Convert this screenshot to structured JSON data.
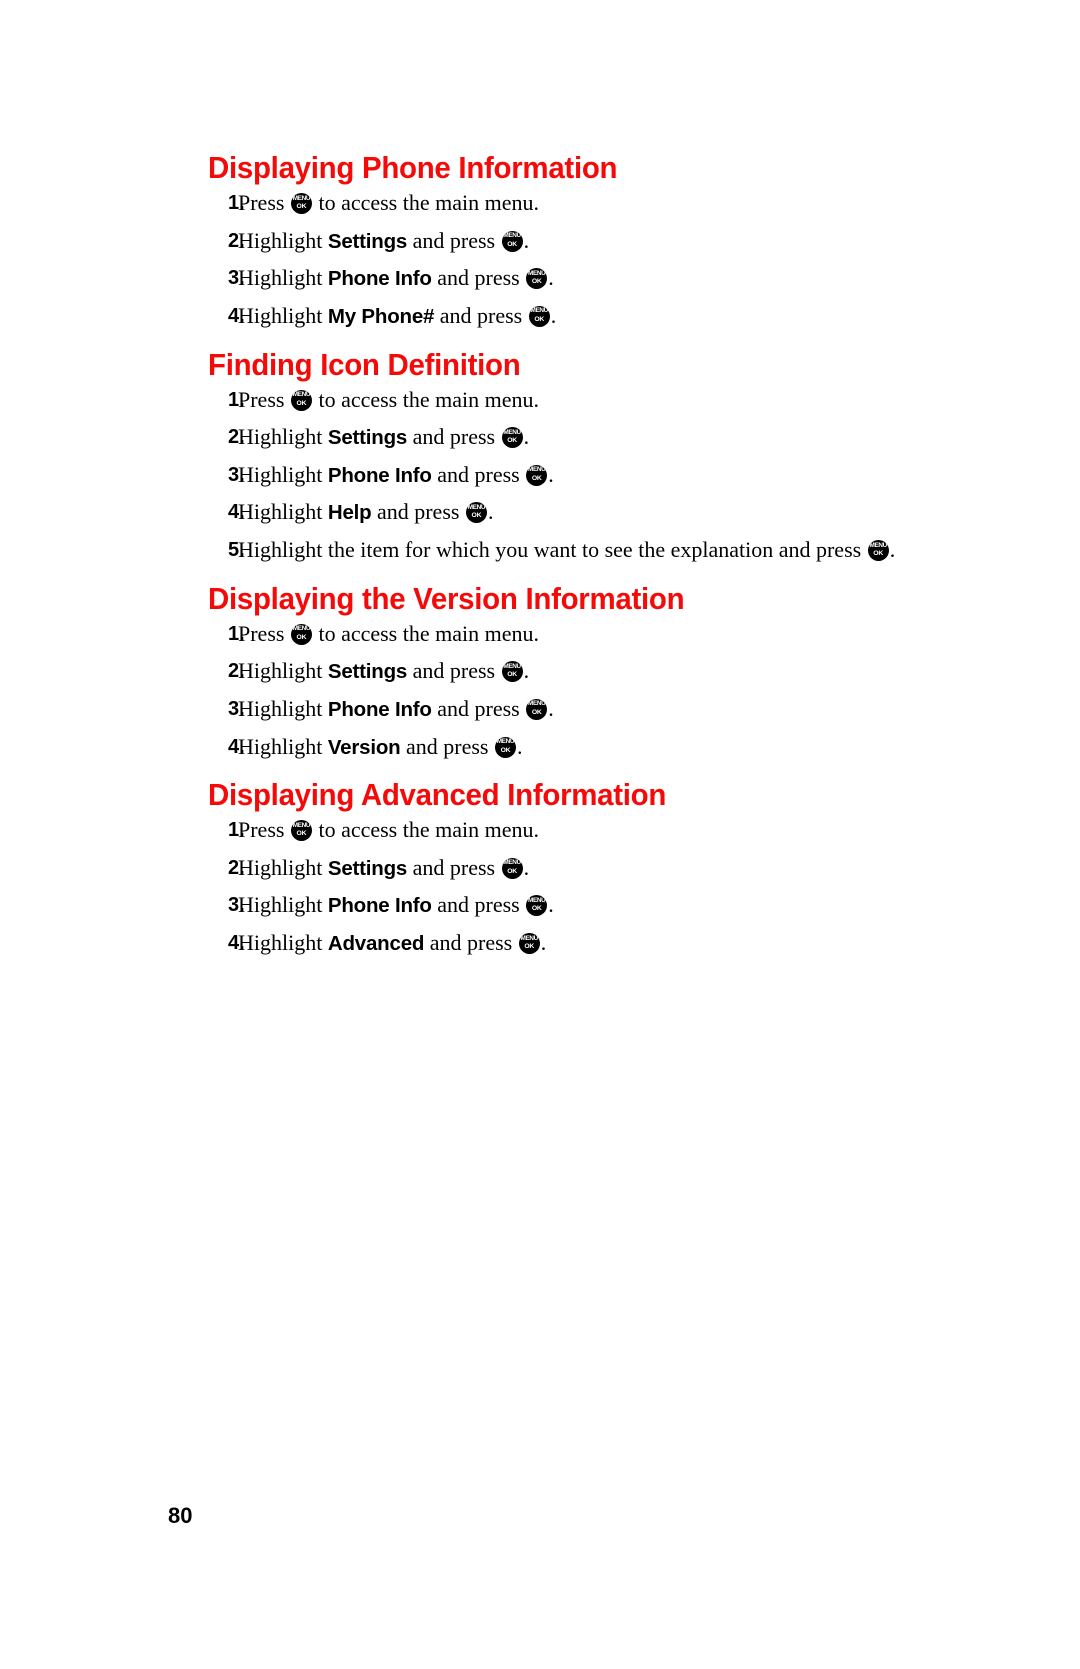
{
  "document": {
    "page_number": "80",
    "heading_color": "#f50a0a",
    "body_color": "#000000",
    "background_color": "#ffffff"
  },
  "key_icon": {
    "name": "menu-ok-key-icon",
    "top_label": "MENU",
    "bottom_label": "OK"
  },
  "sections": [
    {
      "heading": "Displaying Phone Information",
      "steps": [
        {
          "number": "1.",
          "parts": [
            {
              "type": "text",
              "value": "Press "
            },
            {
              "type": "icon"
            },
            {
              "type": "text",
              "value": " to access the main menu."
            }
          ]
        },
        {
          "number": "2.",
          "parts": [
            {
              "type": "text",
              "value": "Highlight "
            },
            {
              "type": "menu",
              "value": "Settings"
            },
            {
              "type": "text",
              "value": " and press "
            },
            {
              "type": "icon"
            },
            {
              "type": "text",
              "value": "."
            }
          ]
        },
        {
          "number": "3.",
          "parts": [
            {
              "type": "text",
              "value": "Highlight "
            },
            {
              "type": "menu",
              "value": "Phone Info"
            },
            {
              "type": "text",
              "value": " and press "
            },
            {
              "type": "icon"
            },
            {
              "type": "text",
              "value": "."
            }
          ]
        },
        {
          "number": "4.",
          "parts": [
            {
              "type": "text",
              "value": "Highlight "
            },
            {
              "type": "menu",
              "value": "My Phone#"
            },
            {
              "type": "text",
              "value": " and press "
            },
            {
              "type": "icon"
            },
            {
              "type": "text",
              "value": "."
            }
          ]
        }
      ]
    },
    {
      "heading": "Finding Icon Definition",
      "steps": [
        {
          "number": "1.",
          "parts": [
            {
              "type": "text",
              "value": "Press "
            },
            {
              "type": "icon"
            },
            {
              "type": "text",
              "value": " to access the main menu."
            }
          ]
        },
        {
          "number": "2.",
          "parts": [
            {
              "type": "text",
              "value": "Highlight "
            },
            {
              "type": "menu",
              "value": "Settings"
            },
            {
              "type": "text",
              "value": " and press "
            },
            {
              "type": "icon"
            },
            {
              "type": "text",
              "value": "."
            }
          ]
        },
        {
          "number": "3.",
          "parts": [
            {
              "type": "text",
              "value": "Highlight "
            },
            {
              "type": "menu",
              "value": "Phone Info"
            },
            {
              "type": "text",
              "value": " and press "
            },
            {
              "type": "icon"
            },
            {
              "type": "text",
              "value": "."
            }
          ]
        },
        {
          "number": "4.",
          "parts": [
            {
              "type": "text",
              "value": "Highlight "
            },
            {
              "type": "menu",
              "value": "Help"
            },
            {
              "type": "text",
              "value": " and press "
            },
            {
              "type": "icon"
            },
            {
              "type": "text",
              "value": "."
            }
          ]
        },
        {
          "number": "5.",
          "parts": [
            {
              "type": "text",
              "value": "Highlight the item for which you want to see the explanation and press "
            },
            {
              "type": "icon"
            },
            {
              "type": "text",
              "value": "."
            }
          ]
        }
      ]
    },
    {
      "heading": "Displaying the Version Information",
      "steps": [
        {
          "number": "1.",
          "parts": [
            {
              "type": "text",
              "value": "Press "
            },
            {
              "type": "icon"
            },
            {
              "type": "text",
              "value": " to access the main menu."
            }
          ]
        },
        {
          "number": "2.",
          "parts": [
            {
              "type": "text",
              "value": "Highlight "
            },
            {
              "type": "menu",
              "value": "Settings"
            },
            {
              "type": "text",
              "value": " and press "
            },
            {
              "type": "icon"
            },
            {
              "type": "text",
              "value": "."
            }
          ]
        },
        {
          "number": "3.",
          "parts": [
            {
              "type": "text",
              "value": "Highlight "
            },
            {
              "type": "menu",
              "value": "Phone Info"
            },
            {
              "type": "text",
              "value": " and press "
            },
            {
              "type": "icon"
            },
            {
              "type": "text",
              "value": "."
            }
          ]
        },
        {
          "number": "4.",
          "parts": [
            {
              "type": "text",
              "value": "Highlight "
            },
            {
              "type": "menu",
              "value": "Version"
            },
            {
              "type": "text",
              "value": " and press "
            },
            {
              "type": "icon"
            },
            {
              "type": "text",
              "value": "."
            }
          ]
        }
      ]
    },
    {
      "heading": "Displaying Advanced Information",
      "steps": [
        {
          "number": "1.",
          "parts": [
            {
              "type": "text",
              "value": "Press "
            },
            {
              "type": "icon"
            },
            {
              "type": "text",
              "value": " to access the main menu."
            }
          ]
        },
        {
          "number": "2.",
          "parts": [
            {
              "type": "text",
              "value": "Highlight "
            },
            {
              "type": "menu",
              "value": "Settings"
            },
            {
              "type": "text",
              "value": " and press "
            },
            {
              "type": "icon"
            },
            {
              "type": "text",
              "value": "."
            }
          ]
        },
        {
          "number": "3.",
          "parts": [
            {
              "type": "text",
              "value": "Highlight "
            },
            {
              "type": "menu",
              "value": "Phone Info"
            },
            {
              "type": "text",
              "value": " and press "
            },
            {
              "type": "icon"
            },
            {
              "type": "text",
              "value": "."
            }
          ]
        },
        {
          "number": "4.",
          "parts": [
            {
              "type": "text",
              "value": "Highlight "
            },
            {
              "type": "menu",
              "value": "Advanced"
            },
            {
              "type": "text",
              "value": " and press "
            },
            {
              "type": "icon"
            },
            {
              "type": "text",
              "value": "."
            }
          ]
        }
      ]
    }
  ]
}
